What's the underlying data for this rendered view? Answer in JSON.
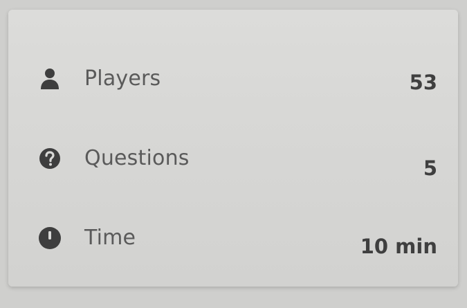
{
  "stats": [
    {
      "icon": "person-icon",
      "label": "Players",
      "value": "53"
    },
    {
      "icon": "question-circle-icon",
      "label": "Questions",
      "value": "5"
    },
    {
      "icon": "clock-icon",
      "label": "Time",
      "value": "10 min"
    }
  ],
  "colors": {
    "background": "#cfcfcd",
    "card": "#d8d8d6",
    "icon": "#3e3e3e",
    "label": "#5a5a5a",
    "value": "#3f3f3f"
  }
}
